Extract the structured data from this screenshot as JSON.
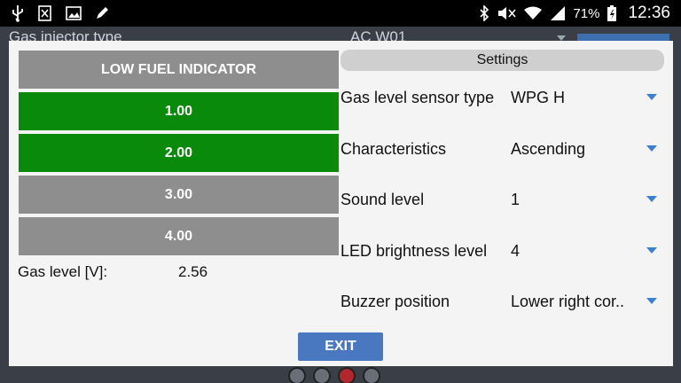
{
  "status_bar": {
    "left_icons": [
      "usb-icon",
      "sim-blocked-icon",
      "image-icon",
      "pen-icon"
    ],
    "right_icons": [
      "bluetooth-icon",
      "mute-icon",
      "wifi-icon",
      "signal-icon",
      "battery-charging-icon"
    ],
    "battery_pct": "71%",
    "time": "12:36"
  },
  "background": {
    "row_label": "Gas injector type",
    "row_value": "AC W01"
  },
  "dialog": {
    "low_fuel": {
      "title": "LOW FUEL INDICATOR",
      "levels": [
        {
          "label": "1.00",
          "active": true
        },
        {
          "label": "2.00",
          "active": true
        },
        {
          "label": "3.00",
          "active": false
        },
        {
          "label": "4.00",
          "active": false
        }
      ],
      "gas_level_label": "Gas level [V]:",
      "gas_level_value": "2.56"
    },
    "settings": {
      "title": "Settings",
      "items": [
        {
          "label": "Gas level sensor type",
          "value": "WPG H"
        },
        {
          "label": "Characteristics",
          "value": "Ascending"
        },
        {
          "label": "Sound level",
          "value": "1"
        },
        {
          "label": "LED brightness level",
          "value": "4"
        },
        {
          "label": "Buzzer position",
          "value": "Lower right cor.."
        }
      ]
    },
    "exit_label": "EXIT"
  },
  "colors": {
    "active_level": "#0a8a0a",
    "inactive_level": "#8e8e8e",
    "accent": "#4a78c0"
  }
}
